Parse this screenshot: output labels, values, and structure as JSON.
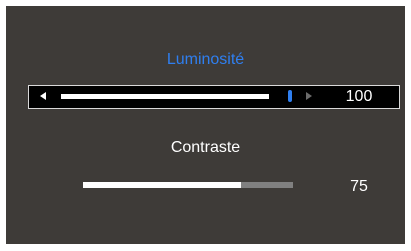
{
  "menu": {
    "selected_item": {
      "label": "Luminosité",
      "value": "100",
      "level_percent": 100,
      "left_icon": "arrow-left-icon",
      "right_icon": "arrow-right-icon"
    },
    "next_item": {
      "label": "Contraste",
      "value": "75",
      "level_percent": 75
    }
  },
  "colors": {
    "background": "#3e3b38",
    "highlight_text": "#2f7ff0",
    "slider_knob": "#2f7ff0",
    "track_fill": "#ffffff",
    "track_empty": "#808080"
  }
}
